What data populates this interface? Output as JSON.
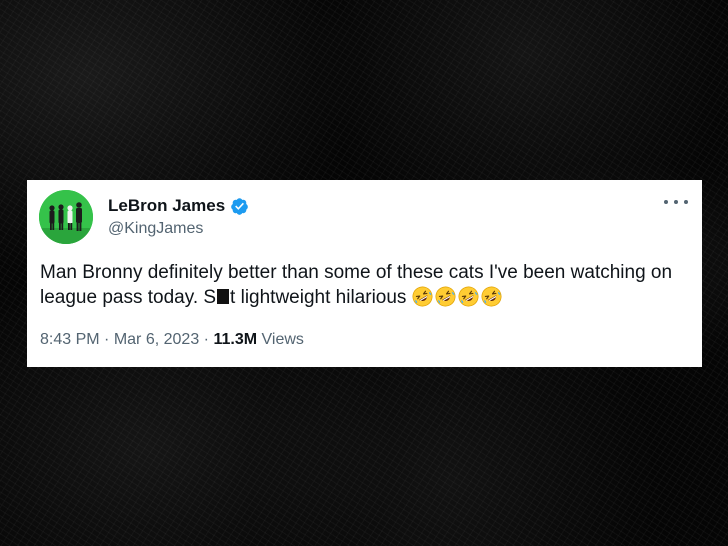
{
  "tweet": {
    "author": {
      "display_name": "LeBron James",
      "handle": "@KingJames",
      "verified": true,
      "avatar_icon": "profile-photo-green-background"
    },
    "text": {
      "part1": "Man Bronny definitely better than some of these cats I've been watching on league pass today.  S",
      "part2": "t lightweight hilarious",
      "emoji": [
        "🤣",
        "🤣",
        "🤣",
        "🤣"
      ]
    },
    "meta": {
      "time": "8:43 PM",
      "separator": "·",
      "date": "Mar 6, 2023",
      "views_count": "11.3M",
      "views_label": "Views"
    },
    "more_icon": "more-horizontal-icon"
  },
  "colors": {
    "text_primary": "#0f1419",
    "text_secondary": "#536471",
    "verified_blue": "#1d9bf0",
    "avatar_bg": "#35c24a",
    "background": "#050505"
  }
}
